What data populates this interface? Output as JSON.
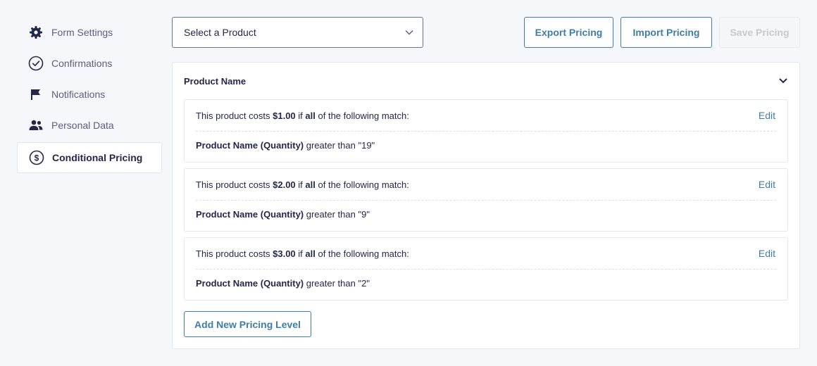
{
  "sidebar": {
    "items": [
      {
        "label": "Form Settings",
        "icon": "gear-icon"
      },
      {
        "label": "Confirmations",
        "icon": "check-circle-icon"
      },
      {
        "label": "Notifications",
        "icon": "flag-icon"
      },
      {
        "label": "Personal Data",
        "icon": "users-icon"
      },
      {
        "label": "Conditional Pricing",
        "icon": "dollar-circle-icon",
        "active": true
      }
    ]
  },
  "toolbar": {
    "product_select": "Select a Product",
    "export_label": "Export Pricing",
    "import_label": "Import Pricing",
    "save_label": "Save Pricing"
  },
  "panel": {
    "title": "Product Name",
    "rules": [
      {
        "prefix": "This product costs",
        "price": "$1.00",
        "mid": "if",
        "logic": "all",
        "suffix": "of the following match:",
        "edit": "Edit",
        "field": "Product Name (Quantity)",
        "operator": "greater than",
        "value": "\"19\""
      },
      {
        "prefix": "This product costs",
        "price": "$2.00",
        "mid": "if",
        "logic": "all",
        "suffix": "of the following match:",
        "edit": "Edit",
        "field": "Product Name (Quantity)",
        "operator": "greater than",
        "value": "\"9\""
      },
      {
        "prefix": "This product costs",
        "price": "$3.00",
        "mid": "if",
        "logic": "all",
        "suffix": "of the following match:",
        "edit": "Edit",
        "field": "Product Name (Quantity)",
        "operator": "greater than",
        "value": "\"2\""
      }
    ],
    "add_label": "Add New Pricing Level"
  },
  "colors": {
    "accent": "#3e7da6",
    "text": "#242748",
    "background": "#f5f7fa"
  }
}
